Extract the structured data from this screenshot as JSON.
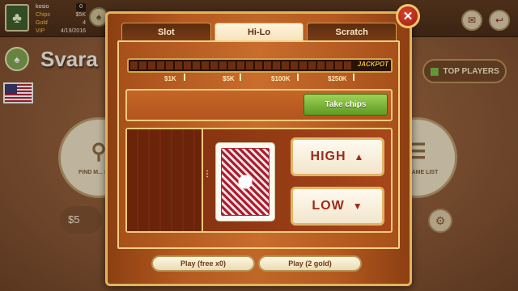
{
  "user": {
    "name": "kosio",
    "name_badge": "0",
    "rows": [
      {
        "label": "Chips",
        "value": "$5K"
      },
      {
        "label": "Gold",
        "value": "4"
      },
      {
        "label": "VIP",
        "value": "4/19/2016"
      }
    ]
  },
  "background": {
    "game_title": "Svara",
    "top_players_label": "TOP PLAYERS",
    "find_table_label": "FIND M... SEAT",
    "new_game_label": "...W GAME LIST",
    "money": "$5"
  },
  "modal": {
    "tabs": [
      {
        "label": "Slot",
        "active": false
      },
      {
        "label": "Hi-Lo",
        "active": true
      },
      {
        "label": "Scratch",
        "active": false
      }
    ],
    "jackpot_label": "JACKPOT",
    "scale": [
      "$1K",
      "$5K",
      "$100K",
      "$250K"
    ],
    "take_chips_label": "Take chips",
    "high_label": "HIGH",
    "low_label": "LOW",
    "play_free_label": "Play (free x0)",
    "play_gold_label": "Play (2 gold)",
    "close_icon": "close-icon"
  },
  "colors": {
    "accent_green": "#7fb33b",
    "button_red_text": "#a02a1a",
    "frame_gold": "#e2b45c"
  }
}
